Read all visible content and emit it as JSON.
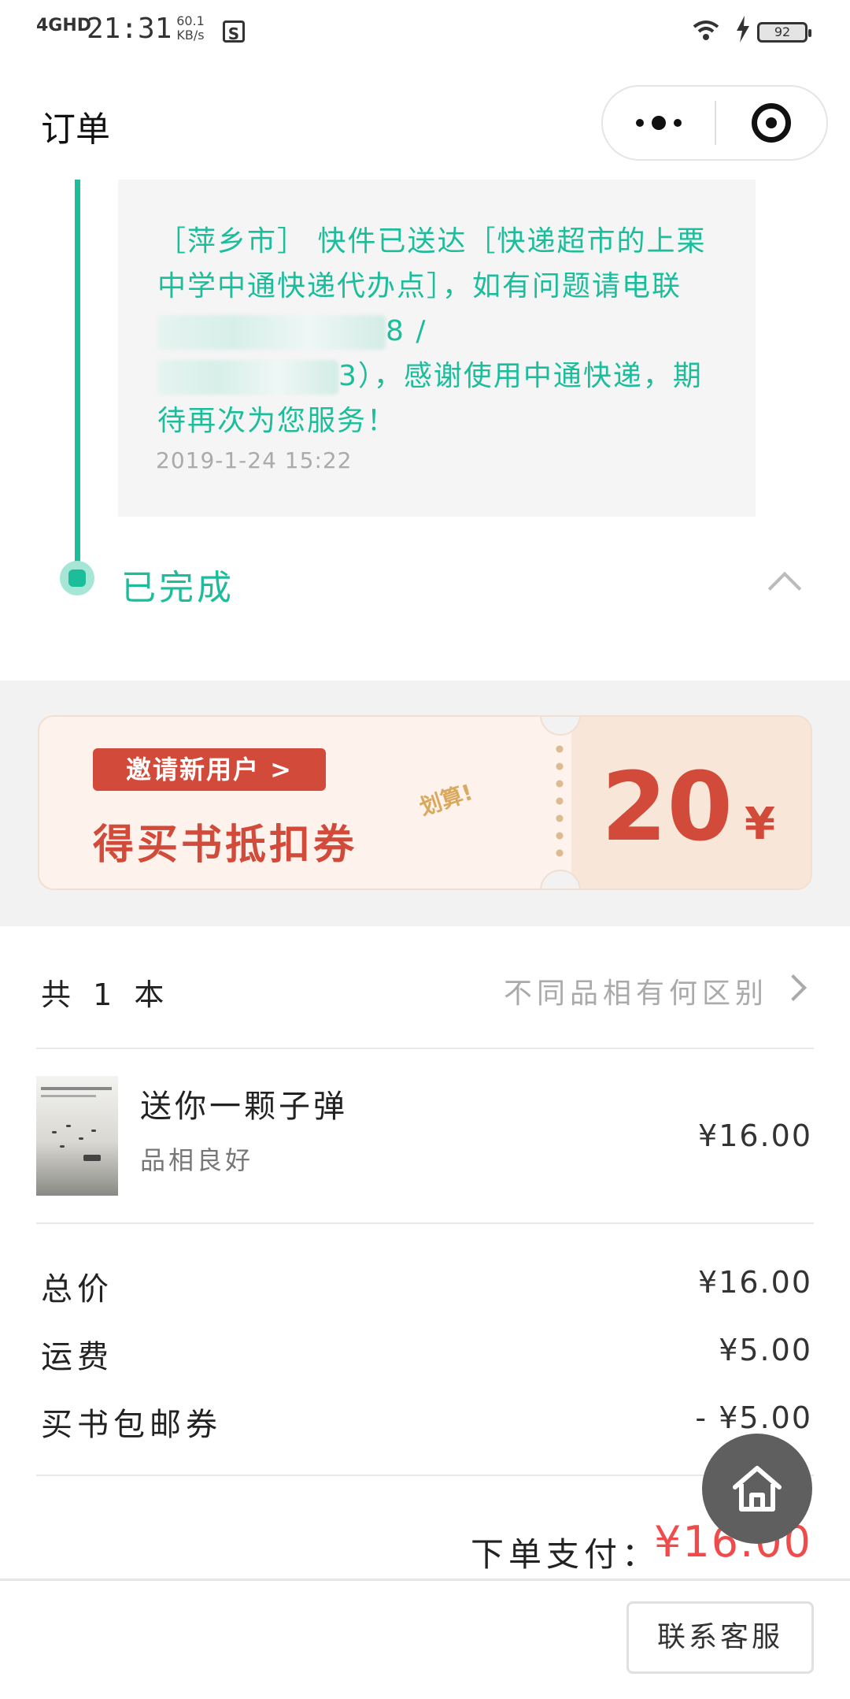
{
  "status_bar": {
    "network": "4GHD",
    "time": "21:31",
    "speed_value": "60.1",
    "speed_unit": "KB/s",
    "s_icon_label": "S",
    "battery": "92"
  },
  "nav": {
    "title": "订单"
  },
  "timeline": {
    "message_part1": "［萍乡市］ 快件已送达［快递超市的上栗中学中通快递代办点］，如有问题请电联",
    "message_part2": "8 /",
    "message_part3": "3），感谢使用中通快递，期待再次为您服务！",
    "time": "2019-1-24 15:22",
    "status": "已完成",
    "accent_color": "#1bbd9a"
  },
  "promo": {
    "invite_label": "邀请新用户 >",
    "headline": "得买书抵扣券",
    "tag": "划算!",
    "amount": "20",
    "currency": "¥",
    "accent_color": "#d24a3a"
  },
  "items": {
    "count_label": "共 1 本",
    "condition_link": "不同品相有何区别",
    "book": {
      "title": "送你一颗子弹",
      "condition": "品相良好",
      "price": "¥16.00"
    }
  },
  "summary": {
    "total_label": "总价",
    "total_value": "¥16.00",
    "shipping_label": "运费",
    "shipping_value": "¥5.00",
    "coupon_label": "买书包邮券",
    "coupon_value": "- ¥5.00",
    "pay_label": "下单支付：",
    "pay_value": "¥16.00",
    "pay_color": "#f04a4a"
  },
  "bottom_bar": {
    "contact_label": "联系客服"
  },
  "icons": {
    "home": "home-icon",
    "more": "more-dots-icon",
    "close": "target-close-icon",
    "collapse": "chevron-up-icon",
    "arrow": "chevron-right-icon"
  }
}
